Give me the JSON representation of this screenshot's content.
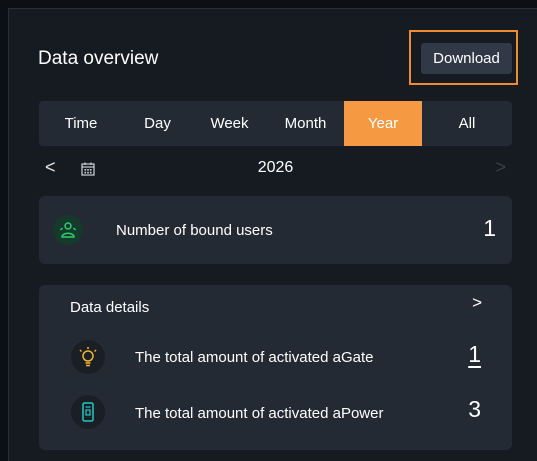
{
  "header": {
    "title": "Data overview",
    "download_label": "Download"
  },
  "tabs": [
    {
      "label": "Time",
      "active": false
    },
    {
      "label": "Day",
      "active": false
    },
    {
      "label": "Week",
      "active": false
    },
    {
      "label": "Month",
      "active": false
    },
    {
      "label": "Year",
      "active": true
    },
    {
      "label": "All",
      "active": false
    }
  ],
  "date_nav": {
    "year": "2026",
    "prev_glyph": "<",
    "next_glyph": ">"
  },
  "users_card": {
    "icon": "users-icon",
    "label": "Number of bound users",
    "value": "1"
  },
  "details": {
    "title": "Data details",
    "chevron": ">",
    "rows": [
      {
        "icon": "lightbulb-icon",
        "label": "The total amount of activated aGate",
        "value": "1"
      },
      {
        "icon": "battery-device-icon",
        "label": "The total amount of activated aPower",
        "value": "3"
      }
    ]
  },
  "colors": {
    "accent_orange": "#f59a42",
    "highlight_border": "#f18a32",
    "green_icon": "#2ecc71",
    "card_bg": "#242a33",
    "panel_bg": "#161a21"
  }
}
